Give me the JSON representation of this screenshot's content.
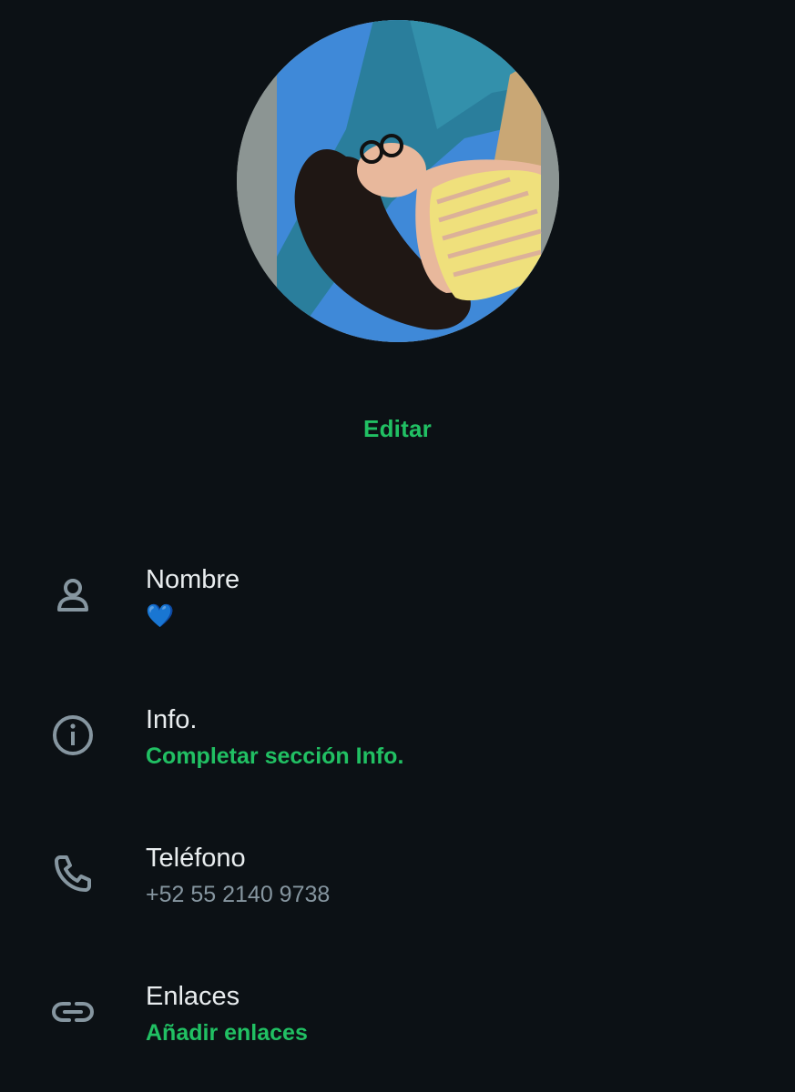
{
  "profile": {
    "photo": {
      "description_icon": "profile-photo",
      "colors": {
        "sky": "#3f89d8",
        "sea": "#2a7e9c",
        "sand": "#c9a775",
        "hair": "#1f1714",
        "top": "#efe07c",
        "skin": "#e8b89c",
        "frame": "#8c9593"
      }
    },
    "edit_label": "Editar"
  },
  "fields": {
    "name": {
      "icon": "person-icon",
      "label": "Nombre",
      "value": "💙"
    },
    "about": {
      "icon": "info-icon",
      "label": "Info.",
      "value": "Completar sección Info."
    },
    "phone": {
      "icon": "phone-icon",
      "label": "Teléfono",
      "value": "+52 55 2140 9738"
    },
    "links": {
      "icon": "link-icon",
      "label": "Enlaces",
      "value": "Añadir enlaces"
    }
  },
  "theme": {
    "background": "#0c1115",
    "accent": "#21c063",
    "icon_color": "#8696a0",
    "primary_text": "#e9edef",
    "secondary_text": "#8696a0"
  }
}
